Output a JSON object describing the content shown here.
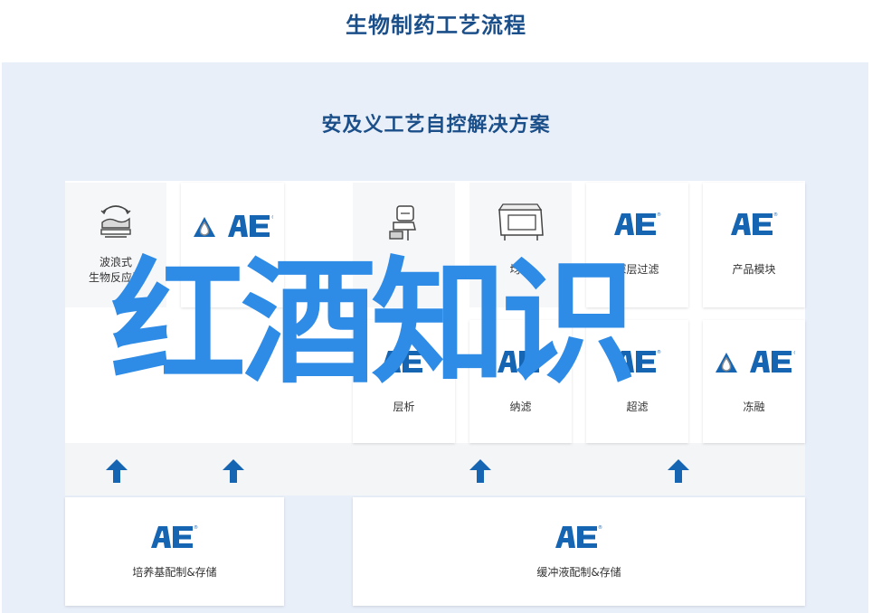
{
  "page_title": "生物制药工艺流程",
  "panel_title": "安及义工艺自控解决方案",
  "overlay_text": "红酒知识",
  "colors": {
    "brand_blue": "#1565b3",
    "title_blue": "#1b4f8a",
    "overlay_blue": "#2e8be6",
    "panel_bg": "#e9eff9"
  },
  "brand_mark": {
    "text": "AE",
    "mark": "®"
  },
  "top_cards": [
    {
      "label": "波浪式",
      "label2": "生物反应器",
      "icon": "wave-bioreactor-icon"
    },
    {
      "label": "",
      "icon": "ae-logo-with-droplet-icon"
    },
    {
      "label": "",
      "icon": "operator-workstation-icon"
    },
    {
      "label": "均质",
      "icon": "homogenizer-machine-icon"
    },
    {
      "label": "深层过滤",
      "icon": "ae-logo-icon"
    },
    {
      "label": "产品模块",
      "icon": "ae-logo-icon"
    }
  ],
  "mid_cards": [
    {
      "label": "层析",
      "icon": "ae-logo-icon"
    },
    {
      "label": "纳滤",
      "icon": "ae-logo-icon"
    },
    {
      "label": "超滤",
      "icon": "ae-logo-icon"
    },
    {
      "label": "冻融",
      "icon": "ae-logo-with-droplet-icon"
    }
  ],
  "bottom_cards": [
    {
      "label": "培养基配制&存储",
      "icon": "ae-logo-icon"
    },
    {
      "label": "缓冲液配制&存储",
      "icon": "ae-logo-icon"
    }
  ],
  "arrows": [
    "up-arrow-icon",
    "up-arrow-icon",
    "up-arrow-icon",
    "up-arrow-icon"
  ]
}
